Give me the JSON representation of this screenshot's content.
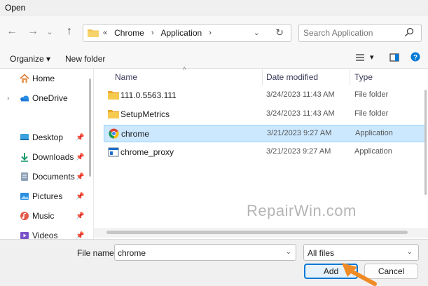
{
  "window": {
    "title": "Open"
  },
  "nav": {
    "back_glyph": "←",
    "forward_glyph": "→",
    "dropdown_glyph": "⌄",
    "up_glyph": "↑"
  },
  "address": {
    "overflow": "«",
    "segments": [
      "Chrome",
      "Application"
    ],
    "separator": "›",
    "dropdown_glyph": "⌄",
    "refresh_glyph": "↻"
  },
  "search": {
    "placeholder": "Search Application"
  },
  "toolbar": {
    "organize_label": "Organize ▾",
    "new_folder_label": "New folder",
    "view_dropdown_glyph": "▾"
  },
  "sidebar": {
    "items": [
      {
        "label": "Home",
        "icon": "home-icon",
        "expandable": false,
        "pinned": false
      },
      {
        "label": "OneDrive",
        "icon": "cloud-icon",
        "expandable": true,
        "pinned": false
      },
      {
        "label": "Desktop",
        "icon": "desktop-icon",
        "expandable": false,
        "pinned": true
      },
      {
        "label": "Downloads",
        "icon": "download-icon",
        "expandable": false,
        "pinned": true
      },
      {
        "label": "Documents",
        "icon": "documents-icon",
        "expandable": false,
        "pinned": true
      },
      {
        "label": "Pictures",
        "icon": "pictures-icon",
        "expandable": false,
        "pinned": true
      },
      {
        "label": "Music",
        "icon": "music-icon",
        "expandable": false,
        "pinned": true
      },
      {
        "label": "Videos",
        "icon": "videos-icon",
        "expandable": false,
        "pinned": true
      }
    ],
    "expand_glyph": "›",
    "pin_glyph": "📌"
  },
  "columns": {
    "name": "Name",
    "date": "Date modified",
    "type": "Type",
    "sort_glyph": "^"
  },
  "files": [
    {
      "name": "111.0.5563.111",
      "date": "3/24/2023 11:43 AM",
      "type": "File folder",
      "icon": "folder-icon",
      "selected": false
    },
    {
      "name": "SetupMetrics",
      "date": "3/24/2023 11:43 AM",
      "type": "File folder",
      "icon": "folder-icon",
      "selected": false
    },
    {
      "name": "chrome",
      "date": "3/21/2023 9:27 AM",
      "type": "Application",
      "icon": "chrome-icon",
      "selected": true
    },
    {
      "name": "chrome_proxy",
      "date": "3/21/2023 9:27 AM",
      "type": "Application",
      "icon": "app-icon",
      "selected": false
    }
  ],
  "watermark": "RepairWin.com",
  "footer": {
    "file_name_label": "File name:",
    "file_name_value": "chrome",
    "file_type_value": "All files",
    "dropdown_glyph": "⌄",
    "add_label": "Add",
    "cancel_label": "Cancel"
  },
  "colors": {
    "accent": "#0078d4",
    "selection": "#cce8ff",
    "annotation_arrow": "#f08a24",
    "folder": "#f2c14e"
  }
}
